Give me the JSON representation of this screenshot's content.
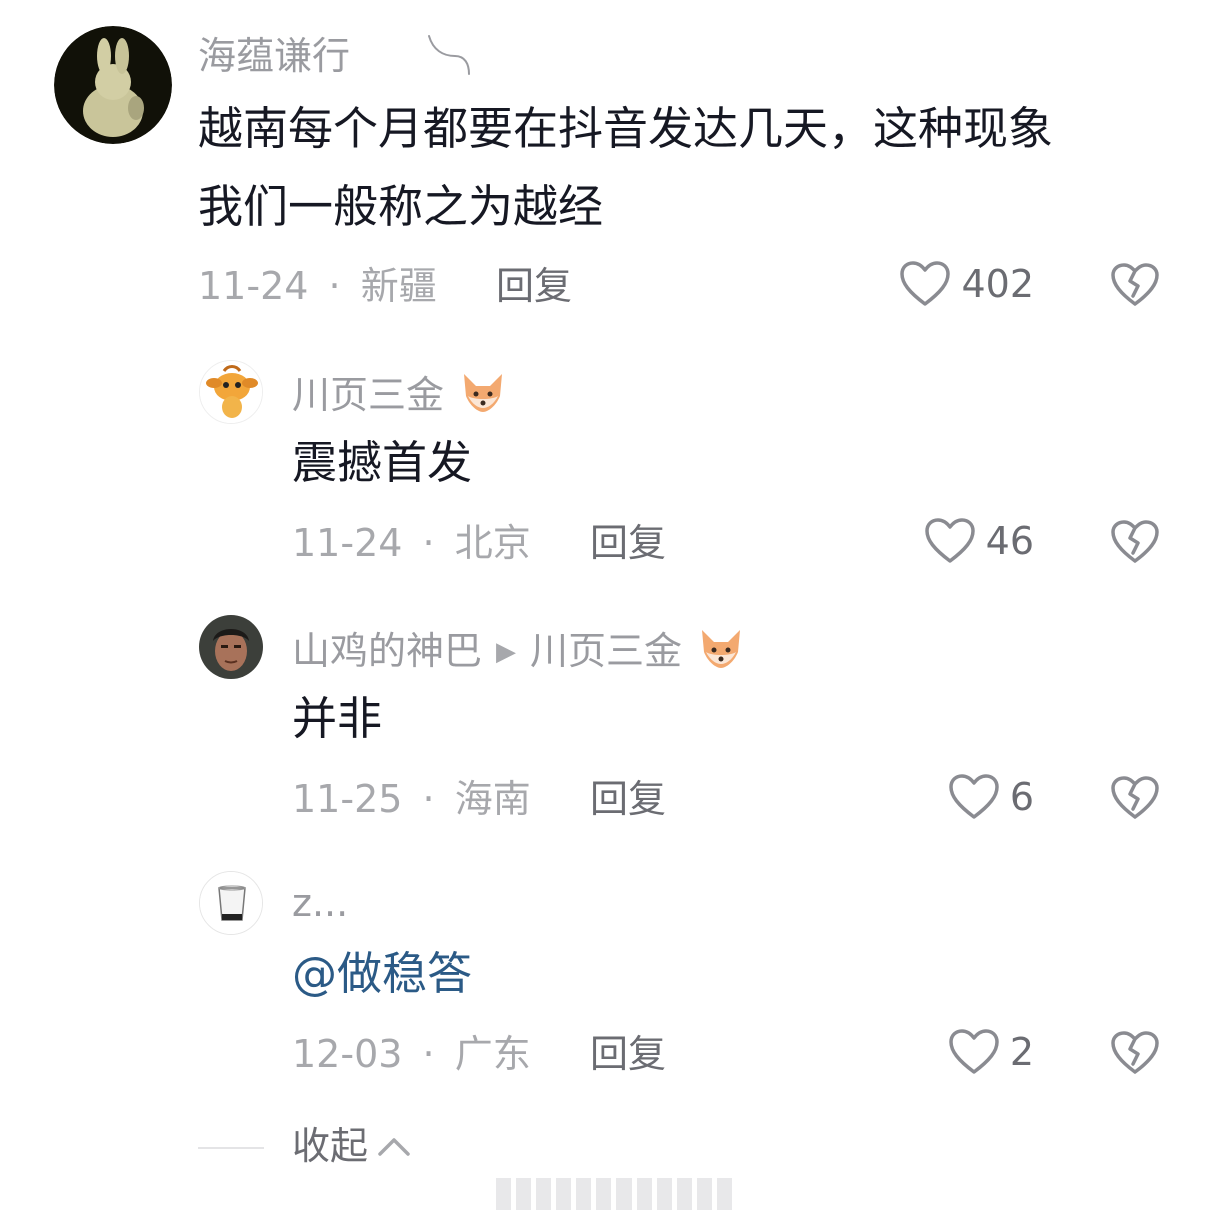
{
  "comments": [
    {
      "username": "海蕴谦行",
      "text_line1": "越南每个月都要在抖音发达几天，这种现象",
      "text_line2": "我们一般称之为越经",
      "date": "11-24",
      "location": "新疆",
      "reply_label": "回复",
      "like_count": "402",
      "avatar_icon": "rabbit-avatar-icon"
    },
    {
      "username": "川页三金",
      "text": "震撼首发",
      "date": "11-24",
      "location": "北京",
      "reply_label": "回复",
      "like_count": "46",
      "avatar_icon": "cartoon-creature-avatar-icon"
    },
    {
      "username": "山鸡的神巴",
      "reply_to": "川页三金",
      "text": "并非",
      "date": "11-25",
      "location": "海南",
      "reply_label": "回复",
      "like_count": "6",
      "avatar_icon": "man-portrait-avatar-icon"
    },
    {
      "username": "z...",
      "text": "@做稳答",
      "date": "12-03",
      "location": "广东",
      "reply_label": "回复",
      "like_count": "2",
      "avatar_icon": "glass-avatar-icon"
    }
  ],
  "collapse_label": "收起",
  "separator": "·",
  "colors": {
    "text_primary": "#161823",
    "text_secondary": "#9a9ba0",
    "mention": "#2b5a86",
    "background": "#ffffff"
  }
}
